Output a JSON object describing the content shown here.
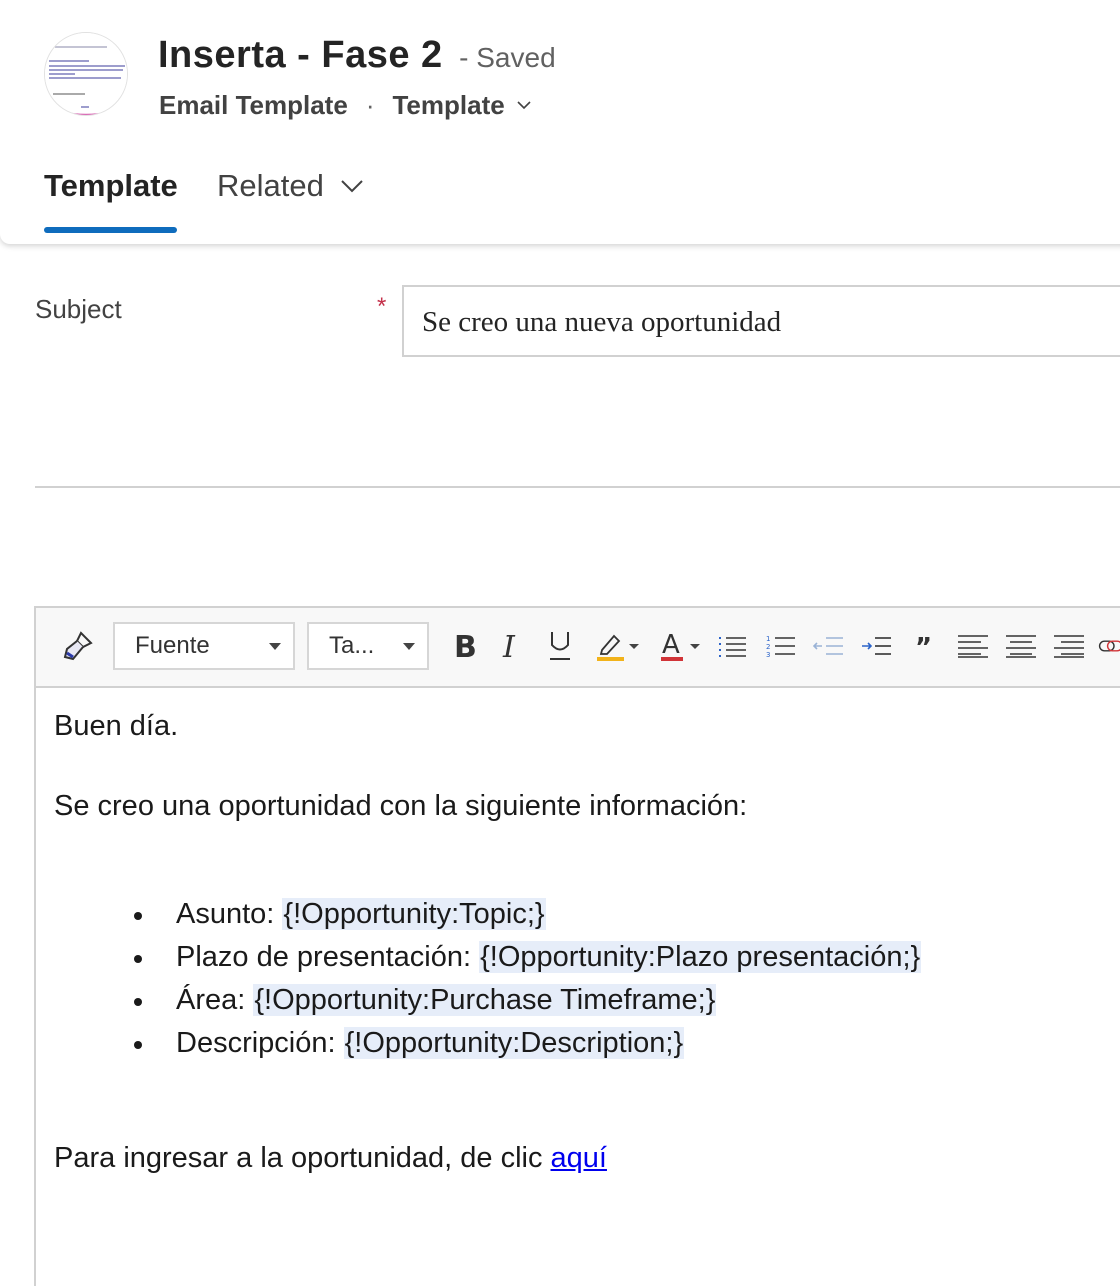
{
  "header": {
    "record_title": "Inserta - Fase 2",
    "save_status": "- Saved",
    "entity_type": "Email Template",
    "separator": "·",
    "form_name": "Template"
  },
  "tabs": [
    {
      "label": "Template",
      "selected": true
    },
    {
      "label": "Related",
      "selected": false
    }
  ],
  "subject_field": {
    "label": "Subject",
    "required_marker": "*",
    "value": "Se creo una nueva oportunidad"
  },
  "editor": {
    "toolbar": {
      "font_label": "Fuente",
      "size_label": "Ta...",
      "buttons": [
        "format-painter",
        "bold",
        "italic",
        "underline",
        "highlight",
        "font-color",
        "bulleted-list",
        "numbered-list",
        "decrease-indent",
        "increase-indent",
        "blockquote",
        "align-left",
        "align-center",
        "align-right",
        "link"
      ]
    },
    "greeting": "Buen día.",
    "intro": "Se creo una oportunidad con la siguiente información:",
    "items": [
      {
        "label": "Asunto: ",
        "token": "{!Opportunity:Topic;}"
      },
      {
        "label": "Plazo de presentación: ",
        "token": "{!Opportunity:Plazo presentación;}"
      },
      {
        "label": "Área: ",
        "token": "{!Opportunity:Purchase Timeframe;}"
      },
      {
        "label": "Descripción: ",
        "token": "{!Opportunity:Description;}"
      }
    ],
    "closing_text": "Para ingresar a la oportunidad, de clic ",
    "closing_link": "aquí"
  },
  "colors": {
    "accent": "#0f6cbd",
    "required": "#c4314b",
    "token_highlight": "#e6edf9",
    "link": "#0000ee"
  }
}
